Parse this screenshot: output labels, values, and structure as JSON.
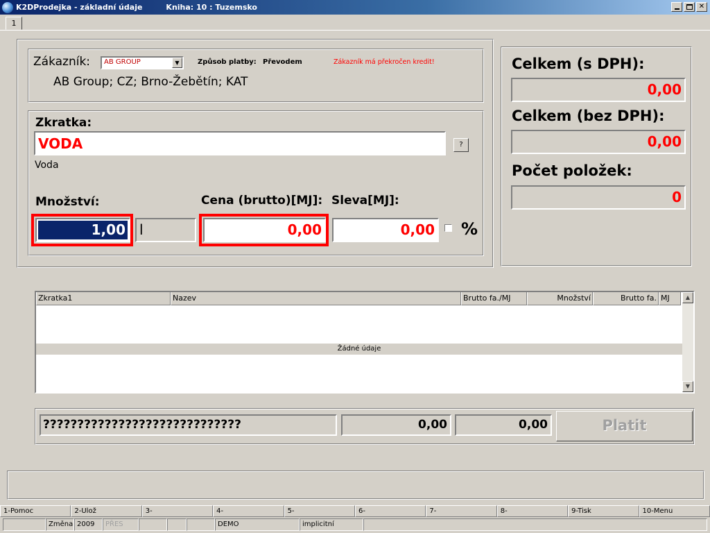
{
  "window": {
    "title": "K2DProdejka - základní údaje",
    "book": "Kniha: 10 : Tuzemsko",
    "minimize_icon": "minimize-icon",
    "maximize_icon": "maximize-icon",
    "close_icon": "close-icon"
  },
  "tabs": [
    {
      "label": "1"
    }
  ],
  "customer": {
    "label": "Zákazník:",
    "selected": "AB GROUP",
    "payment_label": "Způsob platby:",
    "payment_value": "Převodem",
    "warning": "Zákazník má překročen kredit!",
    "details": "AB Group; CZ; Brno-Žebětín; KAT"
  },
  "item": {
    "code_label": "Zkratka:",
    "code_value": "VODA",
    "lookup_button": "?",
    "name": "Voda",
    "qty_label": "Množství:",
    "qty_value": "1,00",
    "unit_value": "l",
    "price_label": "Cena (brutto)[MJ]:",
    "price_value": "0,00",
    "discount_label": "Sleva[MJ]:",
    "discount_value": "0,00",
    "percent_label": "%"
  },
  "totals": {
    "gross_label": "Celkem (s DPH):",
    "gross_value": "0,00",
    "net_label": "Celkem (bez DPH):",
    "net_value": "0,00",
    "count_label": "Počet položek:",
    "count_value": "0"
  },
  "grid": {
    "columns": [
      "Zkratka1",
      "Nazev",
      "Brutto fa./MJ",
      "Množství",
      "Brutto fa.",
      "MJ"
    ],
    "empty_text": "Žádné údaje"
  },
  "summary": {
    "text": "?????????????????????????????",
    "value1": "0,00",
    "value2": "0,00",
    "pay_button": "Platit"
  },
  "function_keys": [
    "1-Pomoc",
    "2-Ulož",
    "3-",
    "4-",
    "5-",
    "6-",
    "7-",
    "8-",
    "9-Tisk",
    "10-Menu"
  ],
  "status": {
    "mode": "Změna",
    "year": "2009",
    "insert": "PŘES",
    "db": "DEMO",
    "profile": "implicitní"
  },
  "colors": {
    "accent_red": "#ff0000",
    "selection_blue": "#0a246a",
    "face": "#d4d0c8"
  }
}
